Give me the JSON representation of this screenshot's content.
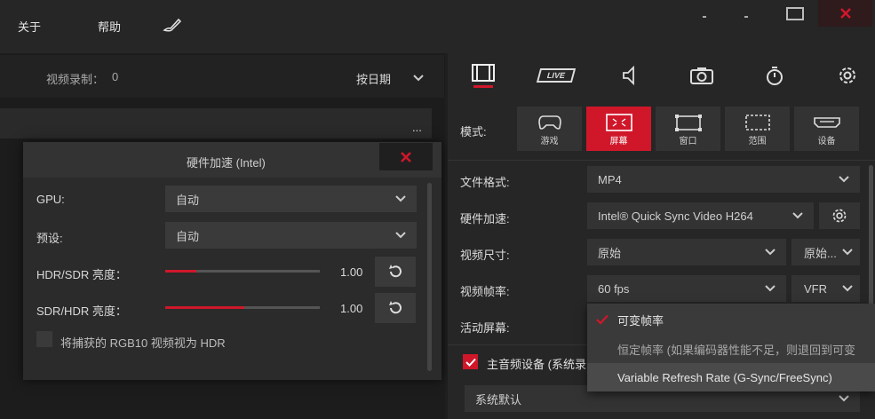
{
  "menu": {
    "about": "关于",
    "help": "帮助"
  },
  "left": {
    "recording_label": "视频录制：",
    "recording_count": "0",
    "sort_label": "按日期",
    "more": "..."
  },
  "hw_dialog": {
    "title": "硬件加速 (Intel)",
    "gpu_label": "GPU:",
    "gpu_value": "自动",
    "preset_label": "预设:",
    "preset_value": "自动",
    "hdr_sdr_label": "HDR/SDR 亮度：",
    "hdr_sdr_value": "1.00",
    "hdr_sdr_level": 0.2,
    "sdr_hdr_label": "SDR/HDR 亮度：",
    "sdr_hdr_value": "1.00",
    "sdr_hdr_level": 0.51,
    "rgb10_label": "将捕获的 RGB10 视频视为 HDR"
  },
  "tabs": [
    {
      "name": "video",
      "icon": "film-icon",
      "label": ""
    },
    {
      "name": "live",
      "icon": "live-icon",
      "label": "LIVE"
    },
    {
      "name": "audio",
      "icon": "speaker-icon",
      "label": ""
    },
    {
      "name": "screenshot",
      "icon": "camera-icon",
      "label": ""
    },
    {
      "name": "timer",
      "icon": "timer-icon",
      "label": ""
    },
    {
      "name": "settings",
      "icon": "gear-icon",
      "label": ""
    }
  ],
  "mode": {
    "label": "模式:",
    "buttons": [
      {
        "name": "game",
        "label": "游戏",
        "icon": "gamepad-icon",
        "active": false
      },
      {
        "name": "screen",
        "label": "屏幕",
        "icon": "screen-icon",
        "active": true
      },
      {
        "name": "window",
        "label": "窗口",
        "icon": "window-icon",
        "active": false
      },
      {
        "name": "area",
        "label": "范围",
        "icon": "area-icon",
        "active": false
      },
      {
        "name": "device",
        "label": "设备",
        "icon": "hdmi-icon",
        "active": false
      }
    ]
  },
  "settings": {
    "format_label": "文件格式:",
    "format_value": "MP4",
    "hwaccel_label": "硬件加速:",
    "hwaccel_value": "Intel® Quick Sync Video H264",
    "size_label": "视频尺寸:",
    "size_value": "原始",
    "size_value2": "原始...",
    "fps_label": "视频帧率:",
    "fps_value": "60 fps",
    "fps_mode": "VFR",
    "active_screen_label": "活动屏幕:",
    "audio_device_label": "主音频设备 (系统录",
    "audio_device_value": "系统默认"
  },
  "fps_dropdown": {
    "items": [
      {
        "label": "可变帧率",
        "checked": true
      },
      {
        "label": "恒定帧率 (如果编码器性能不足，则退回到可变",
        "checked": false
      },
      {
        "label": "Variable Refresh Rate (G-Sync/FreeSync)",
        "checked": false
      }
    ]
  },
  "colors": {
    "accent": "#d0172a",
    "background": "#1f1f1f",
    "panel": "#262626"
  }
}
